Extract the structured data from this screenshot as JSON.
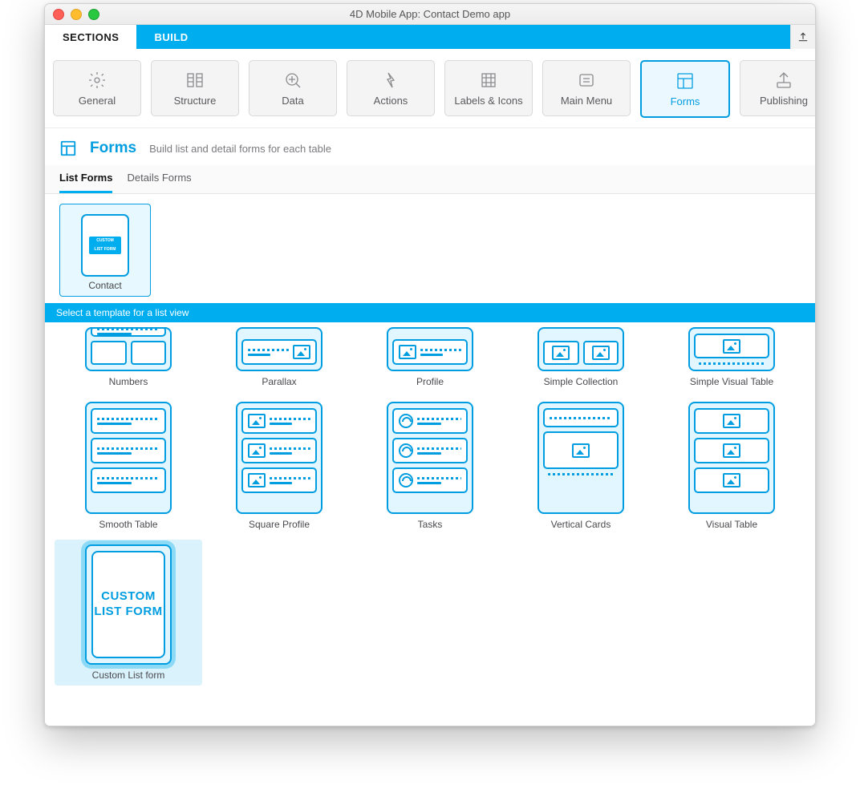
{
  "window": {
    "title": "4D Mobile App: Contact Demo app"
  },
  "topTabs": [
    {
      "label": "SECTIONS",
      "active": true
    },
    {
      "label": "BUILD",
      "active": false
    }
  ],
  "sections": [
    {
      "id": "general",
      "label": "General",
      "selected": false
    },
    {
      "id": "structure",
      "label": "Structure",
      "selected": false
    },
    {
      "id": "data",
      "label": "Data",
      "selected": false
    },
    {
      "id": "actions",
      "label": "Actions",
      "selected": false
    },
    {
      "id": "labels-icons",
      "label": "Labels & Icons",
      "selected": false
    },
    {
      "id": "main-menu",
      "label": "Main Menu",
      "selected": false
    },
    {
      "id": "forms",
      "label": "Forms",
      "selected": true
    },
    {
      "id": "publishing",
      "label": "Publishing",
      "selected": false
    }
  ],
  "page": {
    "title": "Forms",
    "subtitle": "Build list and detail forms for each table"
  },
  "formTabs": [
    {
      "label": "List Forms",
      "active": true
    },
    {
      "label": "Details Forms",
      "active": false
    }
  ],
  "tables": [
    {
      "name": "Contact",
      "badgeLine1": "CUSTOM",
      "badgeLine2": "LIST FORM",
      "selected": true
    }
  ],
  "instructionBar": "Select a template for a list view",
  "templates": [
    {
      "name": "Numbers",
      "selected": false
    },
    {
      "name": "Parallax",
      "selected": false
    },
    {
      "name": "Profile",
      "selected": false
    },
    {
      "name": "Simple Collection",
      "selected": false
    },
    {
      "name": "Simple Visual Table",
      "selected": false
    },
    {
      "name": "Smooth Table",
      "selected": false
    },
    {
      "name": "Square Profile",
      "selected": false
    },
    {
      "name": "Tasks",
      "selected": false
    },
    {
      "name": "Vertical Cards",
      "selected": false
    },
    {
      "name": "Visual Table",
      "selected": false
    },
    {
      "name": "Custom List form",
      "selected": true,
      "innerLabel": "CUSTOM\nLIST FORM"
    }
  ],
  "colors": {
    "accent": "#00aeef",
    "accentStrong": "#009de0"
  }
}
